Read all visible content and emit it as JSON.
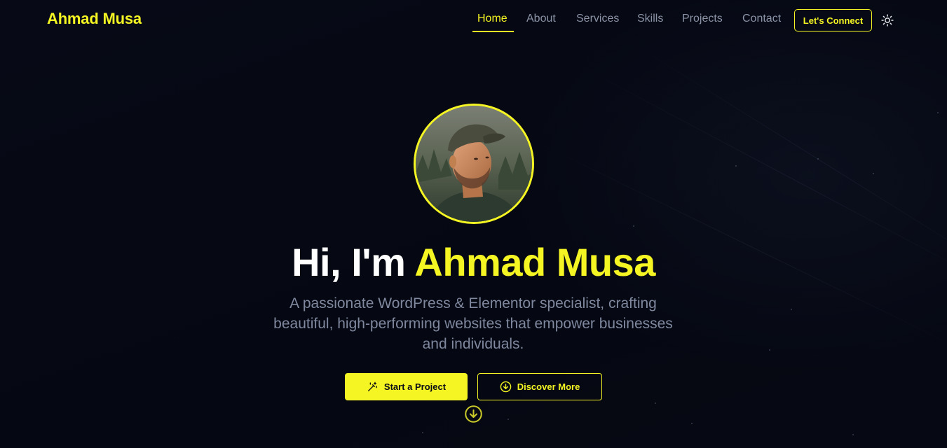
{
  "header": {
    "brand": "Ahmad Musa",
    "nav": [
      {
        "label": "Home",
        "active": true
      },
      {
        "label": "About"
      },
      {
        "label": "Services"
      },
      {
        "label": "Skills"
      },
      {
        "label": "Projects"
      },
      {
        "label": "Contact"
      }
    ],
    "connect_label": "Let's Connect",
    "theme_icon": "sun-icon"
  },
  "hero": {
    "greeting": "Hi, I'm",
    "name": "Ahmad Musa",
    "description": "A passionate WordPress & Elementor specialist, crafting beautiful, high-performing websites that empower businesses and individuals.",
    "primary_button": "Start a Project",
    "primary_icon": "magic-wand-icon",
    "secondary_button": "Discover More",
    "secondary_icon": "arrow-down-circle-icon",
    "scroll_icon": "arrow-down-circle-icon"
  },
  "colors": {
    "background": "#060914",
    "accent": "#f5f523",
    "muted_text": "#7f889e",
    "nav_text": "#8b93a7"
  }
}
